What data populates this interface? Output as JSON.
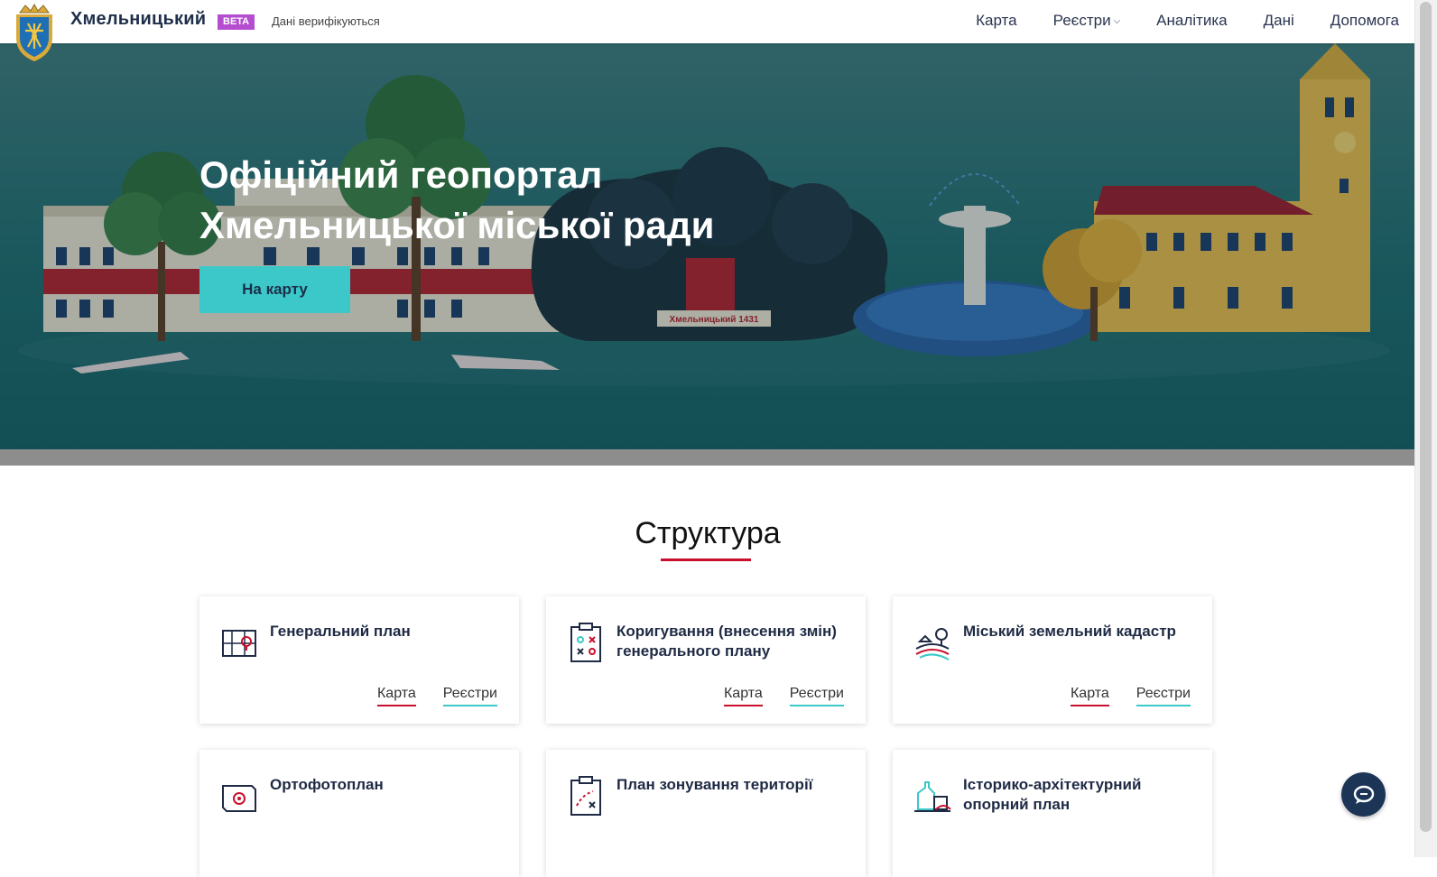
{
  "header": {
    "title": "Хмельницький",
    "beta_label": "BETA",
    "verify_text": "Дані верифікуються",
    "nav": [
      {
        "label": "Карта"
      },
      {
        "label": "Реєстри"
      },
      {
        "label": "Аналітика"
      },
      {
        "label": "Дані"
      },
      {
        "label": "Допомога"
      }
    ]
  },
  "hero": {
    "title_line1": "Офіційний геопортал",
    "title_line2": "Хмельницької міської ради",
    "button_label": "На карту",
    "seal_text": "Хмельницький 1431"
  },
  "structure": {
    "title": "Структура",
    "link_map": "Карта",
    "link_registry": "Реєстри",
    "cards": [
      {
        "title": "Генеральний план",
        "icon": "map-plan-icon"
      },
      {
        "title": "Коригування (внесення змін) генерального плану",
        "icon": "clipboard-plan-icon"
      },
      {
        "title": "Міський земельний кадастр",
        "icon": "land-cadastre-icon"
      },
      {
        "title": "Ортофотоплан",
        "icon": "orthophoto-icon"
      },
      {
        "title": "План зонування території",
        "icon": "zoning-plan-icon"
      },
      {
        "title": "Історико-архітектурний опорний план",
        "icon": "historic-architecture-icon"
      }
    ]
  },
  "colors": {
    "accent_teal": "#3cc8c8",
    "accent_red": "#c8102e",
    "beta_purple": "#b44dd0",
    "navy": "#1c3557"
  }
}
